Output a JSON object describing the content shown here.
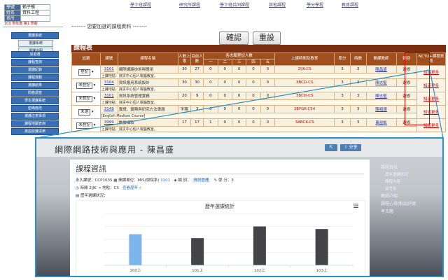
{
  "left": {
    "info": [
      {
        "k": "學號",
        "v": "賴子暢"
      },
      {
        "k": "姓名",
        "v": "資料工程"
      },
      {
        "k": "系所",
        "v": ""
      }
    ],
    "status": "103 學年度 第1 學期",
    "menu_top": [
      "選課系統"
    ],
    "menu_sub": [
      "選課系統",
      "選課說明"
    ],
    "menu": [
      "加退選",
      "課程查詢",
      "選課紀錄",
      "課程異動",
      "選課結果",
      "問卷調查",
      "學生選課系統",
      "密碼修改",
      "選課注意事項",
      "課程地圖查詢",
      "英語授課清單"
    ]
  },
  "topnav": [
    "學士班課程",
    "研究所課程",
    "學士班共同課程",
    "其他課程",
    "學分學程",
    "教育課程"
  ],
  "notice": "-------- 您要加選的課程資料 --------",
  "buttons": {
    "confirm": "確認",
    "reset": "重設"
  },
  "course_table": {
    "title": "課程表",
    "headers": [
      "加選",
      "課號",
      "課程名稱",
      "人數上限",
      "目前人數",
      "一",
      "二",
      "三",
      "四",
      "五",
      "上課時間及教室",
      "學分",
      "時數",
      "開課教師",
      "類別",
      "NCTU+課程資訊"
    ],
    "group_header": "各志願登記人數",
    "rows": [
      {
        "action": "登記",
        "id": "3101",
        "name": "網際網路技術與應用",
        "cap": "30",
        "cur": "27",
        "c1": "0",
        "c2": "0",
        "c3": "0",
        "c4": "0",
        "c5": "0",
        "time": "2IJK-CS",
        "credit": "3",
        "hours": "3",
        "teacher": "陳昌盛",
        "type": "選修",
        "ncu": "知道更多",
        "note": "上課地點：資訊中心個人電腦教室。"
      },
      {
        "action": "未登記",
        "id": "3104",
        "name": "資訊應用系統設計",
        "cap": "30",
        "cur": "30",
        "c1": "0",
        "c2": "0",
        "c3": "0",
        "c4": "0",
        "c5": "0",
        "time": "3BCD-CS",
        "credit": "3",
        "hours": "3",
        "teacher": "陳志堅",
        "type": "選修",
        "ncu": "知道更多",
        "note": "上課地點：資訊中心個人電腦教室。"
      },
      {
        "action": "未登記",
        "id": "3101",
        "name": "資訊系統管理實務",
        "cap": "20",
        "cur": "9",
        "c1": "0",
        "c2": "0",
        "c3": "0",
        "c4": "0",
        "c5": "0",
        "time": "3BCD-CS",
        "credit": "3",
        "hours": "3",
        "teacher": "陳志堅",
        "type": "選修",
        "ncu": "知道更多",
        "note": "上課地點：資訊中心個人電腦教室。"
      },
      {
        "action": "未選",
        "id": "3149",
        "name": "實證、實務與研究方法專題",
        "cap": "不限",
        "cur": "3",
        "c1": "0",
        "c2": "0",
        "c3": "0",
        "c4": "0",
        "c5": "0",
        "time": "2EFGK-C54",
        "credit": "3",
        "hours": "3",
        "teacher": "陳祖德",
        "type": "選修",
        "ncu": "知道更多",
        "note": "[English Medium Course]"
      },
      {
        "action": "未登記",
        "id": "3999",
        "name": "數據擷取",
        "cap": "17",
        "cur": "17",
        "c1": "1",
        "c2": "0",
        "c3": "0",
        "c4": "0",
        "c5": "0",
        "time": "3ABCK-CS",
        "credit": "3",
        "hours": "3",
        "teacher": "黃益凱",
        "type": "選修",
        "ncu": "知道更多",
        "note": "上課地點：資訊中心個人電腦教室。"
      }
    ]
  },
  "popup": {
    "title": "網際網路技術與應用 - 陳昌盛",
    "share_btn": "分享",
    "card_title": "課程資訊",
    "meta_line1_code": "永久課號：CCP1035",
    "meta_line1_dept": "開課單位：MIS(學院系)",
    "meta_line1_id": "3101",
    "meta_line1_type_label": "類 別：",
    "meta_line1_type": "資訊管理",
    "meta_line1_credit": "學 分：3",
    "meta_line2_time": "時間 2IJK",
    "meta_line2_room": "地點：CS",
    "meta_line2_link": "查看歷年",
    "history_label": "歷年選課狀況：",
    "right_menu": [
      "課程資訊",
      "歷年選課狀況",
      "課程內容",
      "留言板",
      "教師介紹",
      "課程心得/對話評價",
      "考古題"
    ]
  },
  "chart_data": {
    "type": "bar",
    "title": "歷年選課統計",
    "categories": [
      "100上",
      "101上",
      "102上",
      "103上"
    ],
    "series": [
      {
        "values": [
          24,
          null,
          null,
          null
        ],
        "color": "#7cb5ec"
      },
      {
        "values": [
          null,
          21,
          30,
          28
        ],
        "color": "#434348"
      }
    ],
    "ylim": [
      0,
      40
    ],
    "grid": true,
    "legend": "none"
  }
}
